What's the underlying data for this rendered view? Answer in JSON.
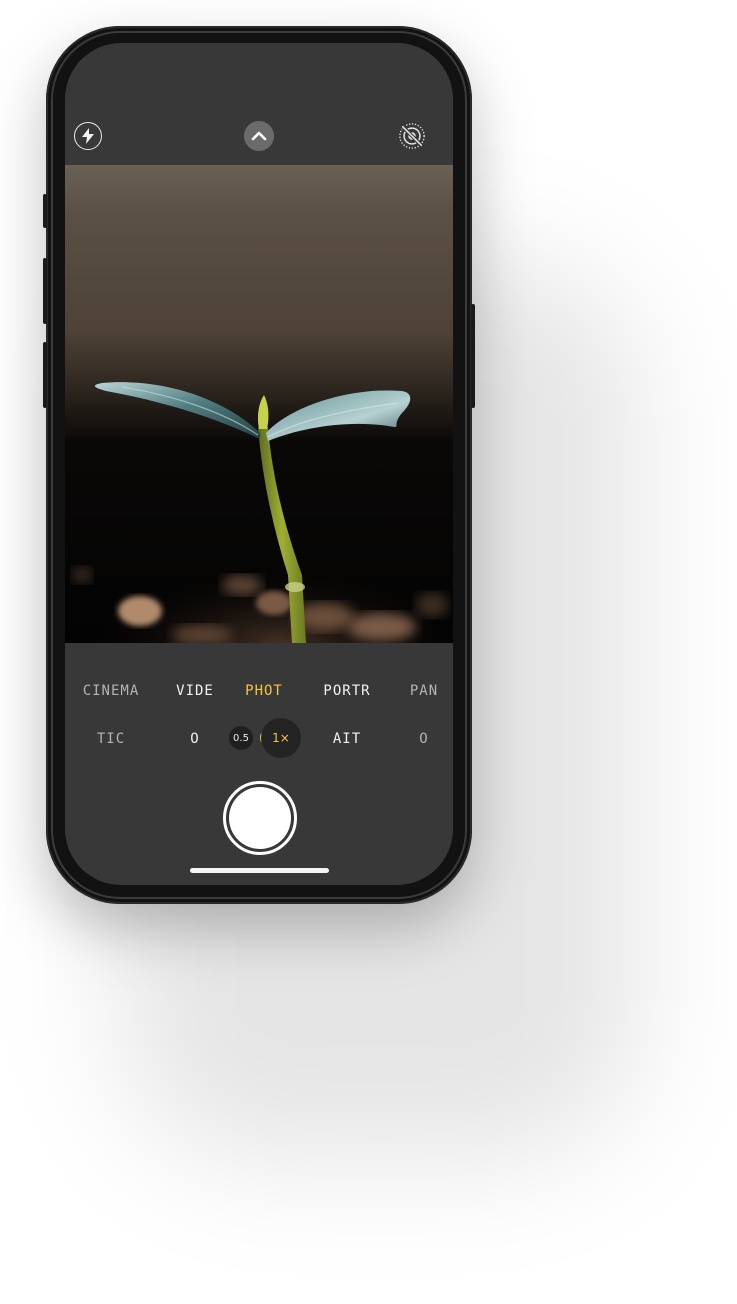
{
  "camera": {
    "top_controls": {
      "flash_icon": "lightning-bolt",
      "expand_icon": "chevron-up",
      "live_photo_icon": "live-photo-off"
    },
    "modes": [
      {
        "line1": "CINEMA",
        "line2": "TIC",
        "state": "dim"
      },
      {
        "line1": "VIDE",
        "line2": "O",
        "state": "normal"
      },
      {
        "line1": "PHOT",
        "line2": "O",
        "state": "active"
      },
      {
        "line1": "PORTR",
        "line2": "AIT",
        "state": "normal"
      },
      {
        "line1": "PAN",
        "line2": "O",
        "state": "dim"
      }
    ],
    "zoom": {
      "wide_label": "0.5",
      "main_label": "1×"
    },
    "colors": {
      "accent": "#f5c542",
      "screen_bg": "#383838"
    }
  }
}
